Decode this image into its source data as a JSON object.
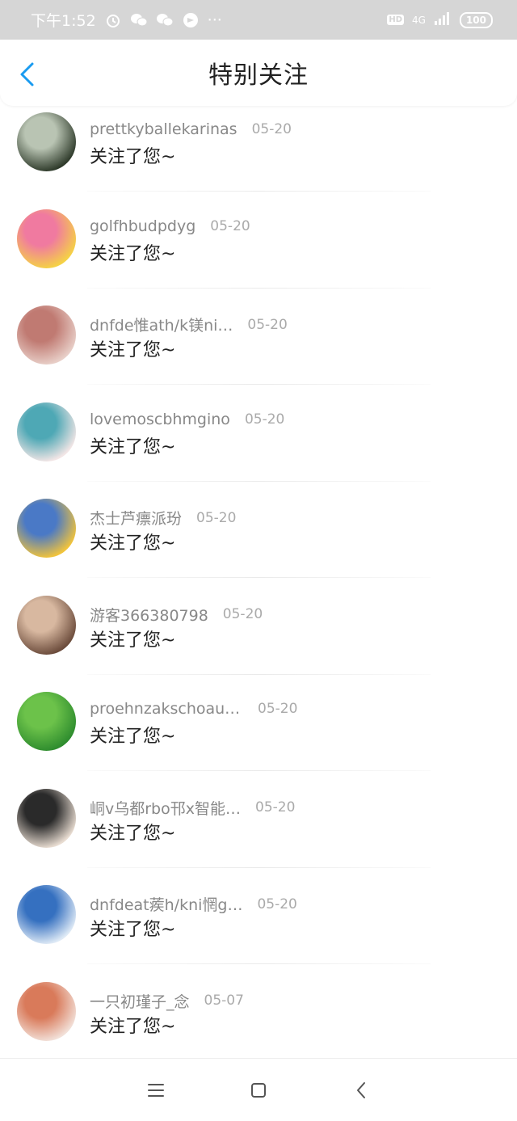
{
  "status_bar": {
    "time": "下午1:52",
    "network": "4G",
    "battery": "100"
  },
  "header": {
    "title": "特别关注"
  },
  "items": [
    {
      "name": "prettkyballekarinas",
      "date": "05-20",
      "message": "关注了您~",
      "avatar_colors": [
        "#2e3a2a",
        "#b9c4b3"
      ]
    },
    {
      "name": "golfhbudpdyg",
      "date": "05-20",
      "message": "关注了您~",
      "avatar_colors": [
        "#f5d245",
        "#f07aa0"
      ]
    },
    {
      "name": "dnfde惟ath/k镁ni…",
      "date": "05-20",
      "message": "关注了您~",
      "avatar_colors": [
        "#e8cfc8",
        "#c07a72"
      ]
    },
    {
      "name": "lovemoscbhmgino",
      "date": "05-20",
      "message": "关注了您~",
      "avatar_colors": [
        "#f3e6e6",
        "#4ea8b5"
      ]
    },
    {
      "name": "杰士芦瘭派玢",
      "date": "05-20",
      "message": "关注了您~",
      "avatar_colors": [
        "#f2c43b",
        "#4a79c6"
      ]
    },
    {
      "name": "游客366380798",
      "date": "05-20",
      "message": "关注了您~",
      "avatar_colors": [
        "#6b4b3b",
        "#d8b8a0"
      ]
    },
    {
      "name": "proehnzakschoaul…",
      "date": "05-20",
      "message": "关注了您~",
      "avatar_colors": [
        "#2e8c2e",
        "#6cc24a"
      ]
    },
    {
      "name": "峒v乌都rbo邗x智能…",
      "date": "05-20",
      "message": "关注了您~",
      "avatar_colors": [
        "#e9ddd2",
        "#2a2a2a"
      ]
    },
    {
      "name": "dnfdeat蒺h/kni惘g…",
      "date": "05-20",
      "message": "关注了您~",
      "avatar_colors": [
        "#dfeaf6",
        "#3570c0"
      ]
    },
    {
      "name": "一只初瑾子_念",
      "date": "05-07",
      "message": "关注了您~",
      "avatar_colors": [
        "#f2e0d8",
        "#d97a5a"
      ]
    }
  ],
  "nav": {
    "menu_icon": "menu-icon",
    "home_icon": "home-square-icon",
    "back_icon": "back-triangle-icon"
  }
}
